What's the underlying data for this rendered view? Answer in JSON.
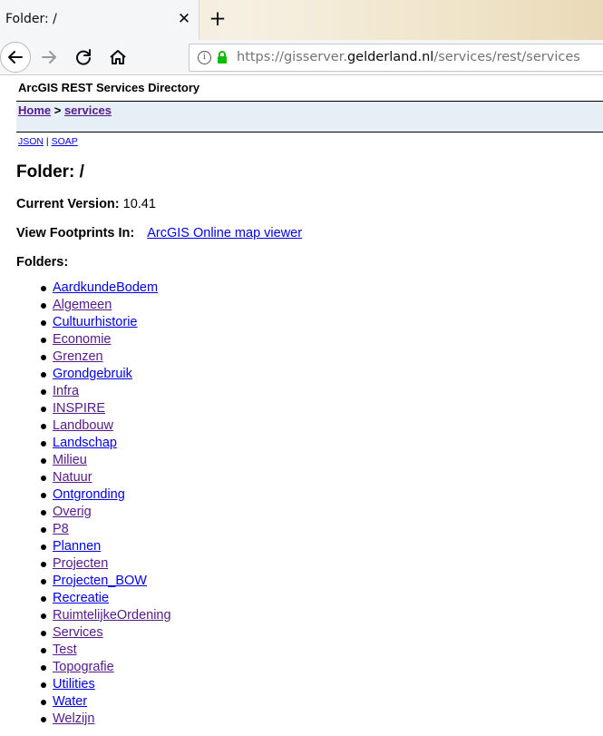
{
  "browser": {
    "tab_title": "Folder: /",
    "tab_close": "✕",
    "new_tab": "+",
    "url_prefix": "https://gisserver.",
    "url_host": "gelderland.nl",
    "url_path": "/services/rest/services"
  },
  "page": {
    "directory_title": "ArcGIS REST Services Directory",
    "breadcrumb": {
      "home": "Home",
      "separator": " > ",
      "services": "services"
    },
    "formats": {
      "json": "JSON",
      "separator": " | ",
      "soap": "SOAP"
    },
    "title": "Folder: /",
    "version_label": "Current Version:",
    "version_value": "10.41",
    "footprints_label": "View Footprints In:",
    "footprints_link": "ArcGIS Online map viewer",
    "folders_label": "Folders:",
    "folders": [
      {
        "name": "AardkundeBodem",
        "visited": false
      },
      {
        "name": "Algemeen",
        "visited": true
      },
      {
        "name": "Cultuurhistorie",
        "visited": false
      },
      {
        "name": "Economie",
        "visited": true
      },
      {
        "name": "Grenzen",
        "visited": true
      },
      {
        "name": "Grondgebruik",
        "visited": false
      },
      {
        "name": "Infra",
        "visited": true
      },
      {
        "name": "INSPIRE",
        "visited": true
      },
      {
        "name": "Landbouw",
        "visited": true
      },
      {
        "name": "Landschap",
        "visited": false
      },
      {
        "name": "Milieu",
        "visited": true
      },
      {
        "name": "Natuur",
        "visited": true
      },
      {
        "name": "Ontgronding",
        "visited": false
      },
      {
        "name": "Overig",
        "visited": true
      },
      {
        "name": "P8",
        "visited": true
      },
      {
        "name": "Plannen",
        "visited": false
      },
      {
        "name": "Projecten",
        "visited": true
      },
      {
        "name": "Projecten_BOW",
        "visited": false
      },
      {
        "name": "Recreatie",
        "visited": false
      },
      {
        "name": "RuimtelijkeOrdening",
        "visited": true
      },
      {
        "name": "Services",
        "visited": true
      },
      {
        "name": "Test",
        "visited": true
      },
      {
        "name": "Topografie",
        "visited": true
      },
      {
        "name": "Utilities",
        "visited": false
      },
      {
        "name": "Water",
        "visited": false
      },
      {
        "name": "Welzijn",
        "visited": true
      }
    ]
  }
}
